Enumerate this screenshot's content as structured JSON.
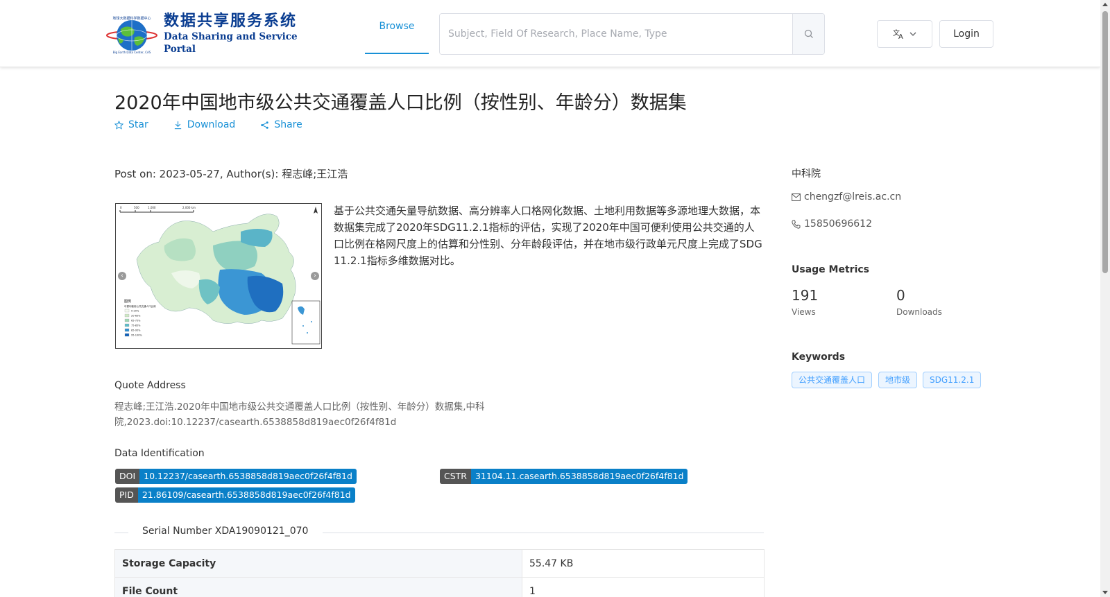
{
  "header": {
    "logo_cn": "数据共享服务系统",
    "logo_en": "Data Sharing and Service Portal",
    "logo_small_text": "地球大数据科学数据中心",
    "nav_browse": "Browse",
    "search_placeholder": "Subject, Field Of Research, Place Name, Type",
    "lang_icon": "translate-icon",
    "login": "Login",
    "accent_color": "#1890d6"
  },
  "dataset": {
    "title": "2020年中国地市级公共交通覆盖人口比例（按性别、年龄分）数据集",
    "actions": {
      "star": "Star",
      "download": "Download",
      "share": "Share"
    },
    "post_line": "Post on: 2023-05-27, Author(s): 程志峰;王江浩",
    "description": "基于公共交通矢量导航数据、高分辨率人口格网化数据、土地利用数据等多源地理大数据，本数据集完成了2020年SDG11.2.1指标的评估，实现了2020年中国可便利使用公共交通的人口比例在格网尺度上的估算和分性别、分年龄段评估，并在地市级行政单元尺度上完成了SDG 11.2.1指标多维数据对比。",
    "thumbnail": {
      "scale_labels": [
        "0",
        "500",
        "1,000",
        "2,000 km"
      ],
      "legend_title": "图例",
      "legend_subtitle": "可便利使用公共交通人口比例",
      "legend_items": [
        "0-20%",
        "20-65%",
        "65-75%",
        "75-85%",
        "85-95%",
        "95-100%"
      ],
      "legend_colors": [
        "#f4faf0",
        "#cfe9c6",
        "#9fd6b4",
        "#5fbcc8",
        "#2e8fd0",
        "#1060b8"
      ]
    },
    "quote_label": "Quote Address",
    "quote_text": "程志峰;王江浩.2020年中国地市级公共交通覆盖人口比例（按性别、年龄分）数据集,中科院,2023.doi:10.12237/casearth.6538858d819aec0f26f4f81d",
    "identification_label": "Data Identification",
    "ids": {
      "doi_key": "DOI",
      "doi_value": "10.12237/casearth.6538858d819aec0f26f4f81d",
      "cstr_key": "CSTR",
      "cstr_value": "31104.11.casearth.6538858d819aec0f26f4f81d",
      "pid_key": "PID",
      "pid_value": "21.86109/casearth.6538858d819aec0f26f4f81d"
    },
    "serial": "Serial Number XDA19090121_070",
    "table": [
      {
        "key": "Storage Capacity",
        "value": "55.47 KB"
      },
      {
        "key": "File Count",
        "value": "1"
      }
    ]
  },
  "sidebar": {
    "org": "中科院",
    "email": "chengzf@lreis.ac.cn",
    "phone": "15850696612",
    "metrics_title": "Usage Metrics",
    "views_count": "191",
    "views_label": "Views",
    "downloads_count": "0",
    "downloads_label": "Downloads",
    "keywords_title": "Keywords",
    "keywords": [
      "公共交通覆盖人口",
      "地市级",
      "SDG11.2.1"
    ]
  }
}
